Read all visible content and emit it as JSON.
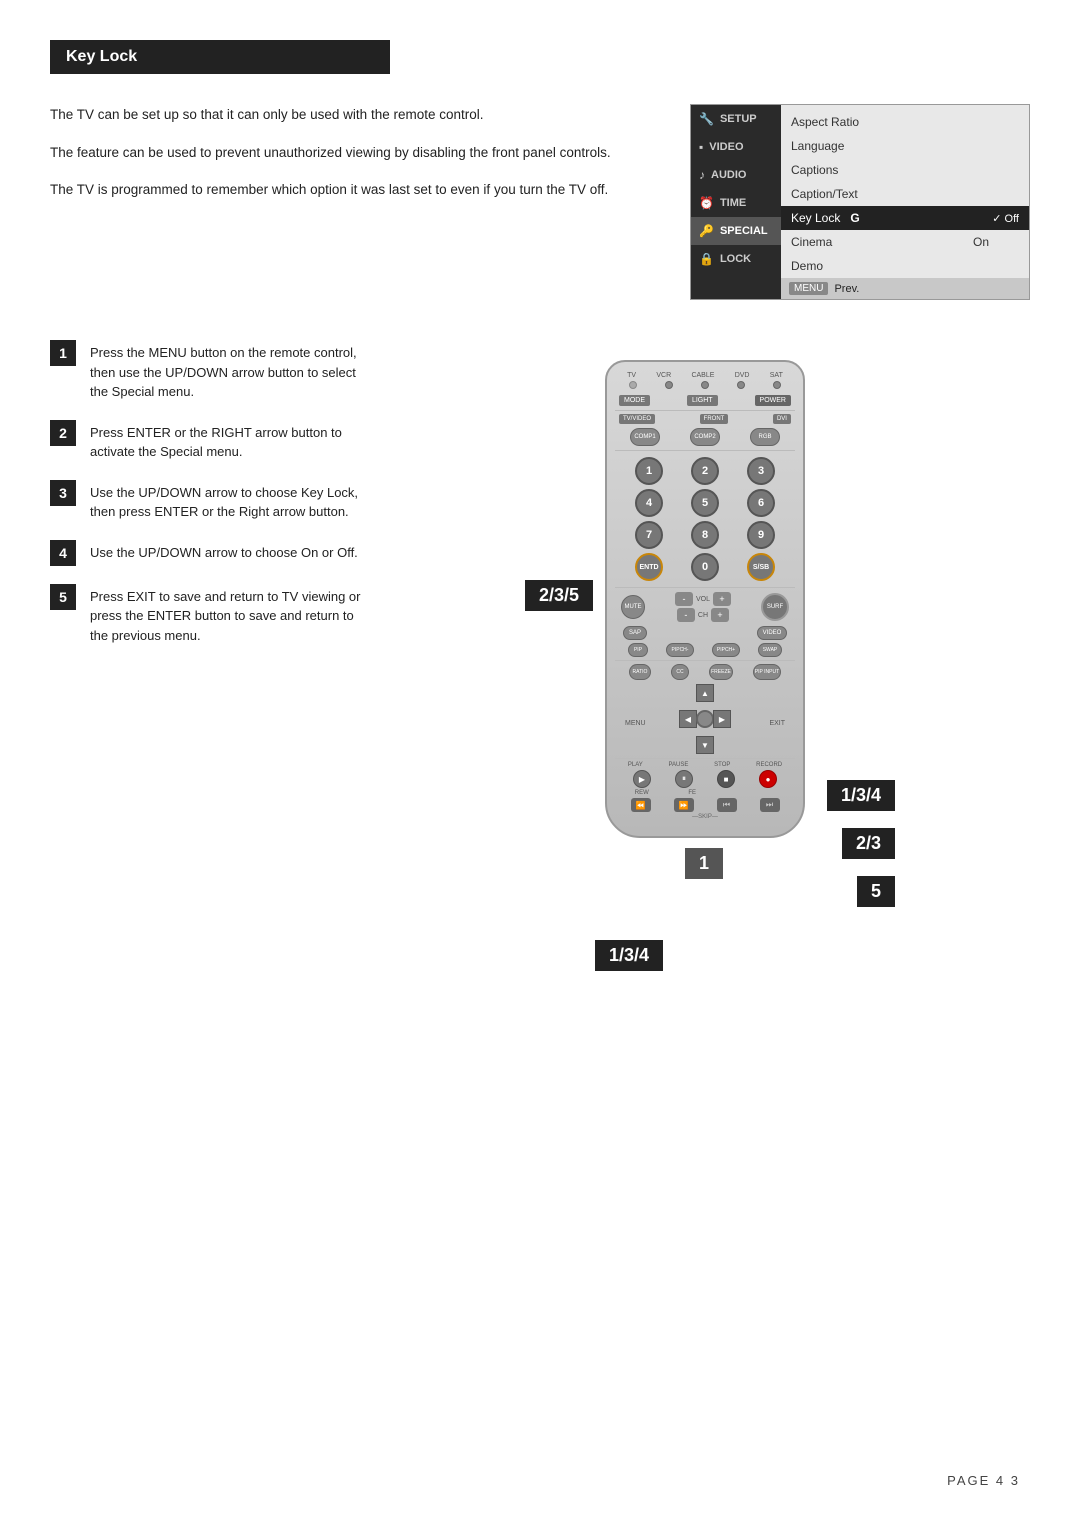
{
  "page": {
    "title": "Key Lock",
    "page_number": "PAGE  4 3"
  },
  "top_text": {
    "para1": "The TV can be set up so that it can only be used with the remote control.",
    "para2": "The feature can be used to prevent unauthorized viewing by disabling the front panel controls.",
    "para3": "The TV is programmed to remember which option it was last set to even if you turn the TV off."
  },
  "menu": {
    "left_items": [
      {
        "label": "SETUP",
        "icon": "🔧",
        "active": false
      },
      {
        "label": "VIDEO",
        "icon": "▪",
        "active": false
      },
      {
        "label": "AUDIO",
        "icon": "🎵",
        "active": false
      },
      {
        "label": "TIME",
        "icon": "⏰",
        "active": false
      },
      {
        "label": "SPECIAL",
        "icon": "🔑",
        "active": true
      },
      {
        "label": "LOCK",
        "icon": "🔒",
        "active": false
      }
    ],
    "right_items": [
      {
        "label": "Aspect Ratio",
        "highlighted": false
      },
      {
        "label": "Language",
        "highlighted": false
      },
      {
        "label": "Captions",
        "highlighted": false
      },
      {
        "label": "Caption/Text",
        "highlighted": false
      },
      {
        "label": "Key Lock",
        "highlighted": true,
        "option_label": "G",
        "options": [
          "✓ Off",
          "On"
        ]
      },
      {
        "label": "Cinema",
        "highlighted": false
      },
      {
        "label": "Demo",
        "highlighted": false
      }
    ],
    "bottom": {
      "btn_label": "MENU",
      "btn_text": "Prev."
    }
  },
  "steps": [
    {
      "num": "1",
      "text": "Press the MENU button on the remote control, then use the UP/DOWN arrow button to select the Special menu."
    },
    {
      "num": "2",
      "text": "Press ENTER or the RIGHT arrow button to activate the Special menu."
    },
    {
      "num": "3",
      "text": "Use the UP/DOWN arrow to choose Key Lock, then press ENTER or the Right arrow button."
    },
    {
      "num": "4",
      "text": "Use the UP/DOWN arrow to  choose On or Off."
    },
    {
      "num": "5",
      "text": "Press EXIT to save and return to TV viewing or press the ENTER button to save and return to the previous menu."
    }
  ],
  "remote_badges": {
    "badge_235": "2/3/5",
    "badge_134_top": "1/3/4",
    "badge_23": "2/3",
    "badge_5": "5",
    "badge_134_bottom": "1/3/4",
    "badge_1": "1"
  },
  "remote": {
    "source_labels": [
      "TV",
      "VCR",
      "CABLE",
      "DVD",
      "SAT"
    ],
    "mode_btn": "MODE",
    "light_btn": "LIGHT",
    "power_btn": "POWER",
    "tv_video_btn": "TV/VIDEO",
    "front_btn": "FRONT",
    "dvi_btn": "DVI",
    "comp1_btn": "COMP1",
    "comp2_btn": "COMP2",
    "rgb_btn": "RGB",
    "numbers": [
      "1",
      "2",
      "3",
      "4",
      "5",
      "6",
      "7",
      "8",
      "9",
      "ENTD",
      "0",
      "S/SB"
    ],
    "mute_btn": "MUTE",
    "sap_btn": "SAP",
    "vol_label": "VOL",
    "ch_label": "CH",
    "surf_btn": "SURF",
    "video_btn": "VIDEO",
    "pip_btn": "PIP",
    "pipch_minus": "PIPCH-",
    "pipch_plus": "PIPCH+",
    "swap_btn": "SWAP",
    "ratio_btn": "RATIO",
    "cc_btn": "CC",
    "freeze_btn": "FREEZE",
    "pip_input_btn": "PIP INPUT",
    "menu_btn": "MENU",
    "exit_btn": "EXIT",
    "play_btn": "PLAY",
    "pause_btn": "PAUSE",
    "stop_btn": "STOP",
    "record_btn": "RECORD",
    "rew_btn": "REW",
    "fe_btn": "FE",
    "skip_label": "SKIP"
  }
}
